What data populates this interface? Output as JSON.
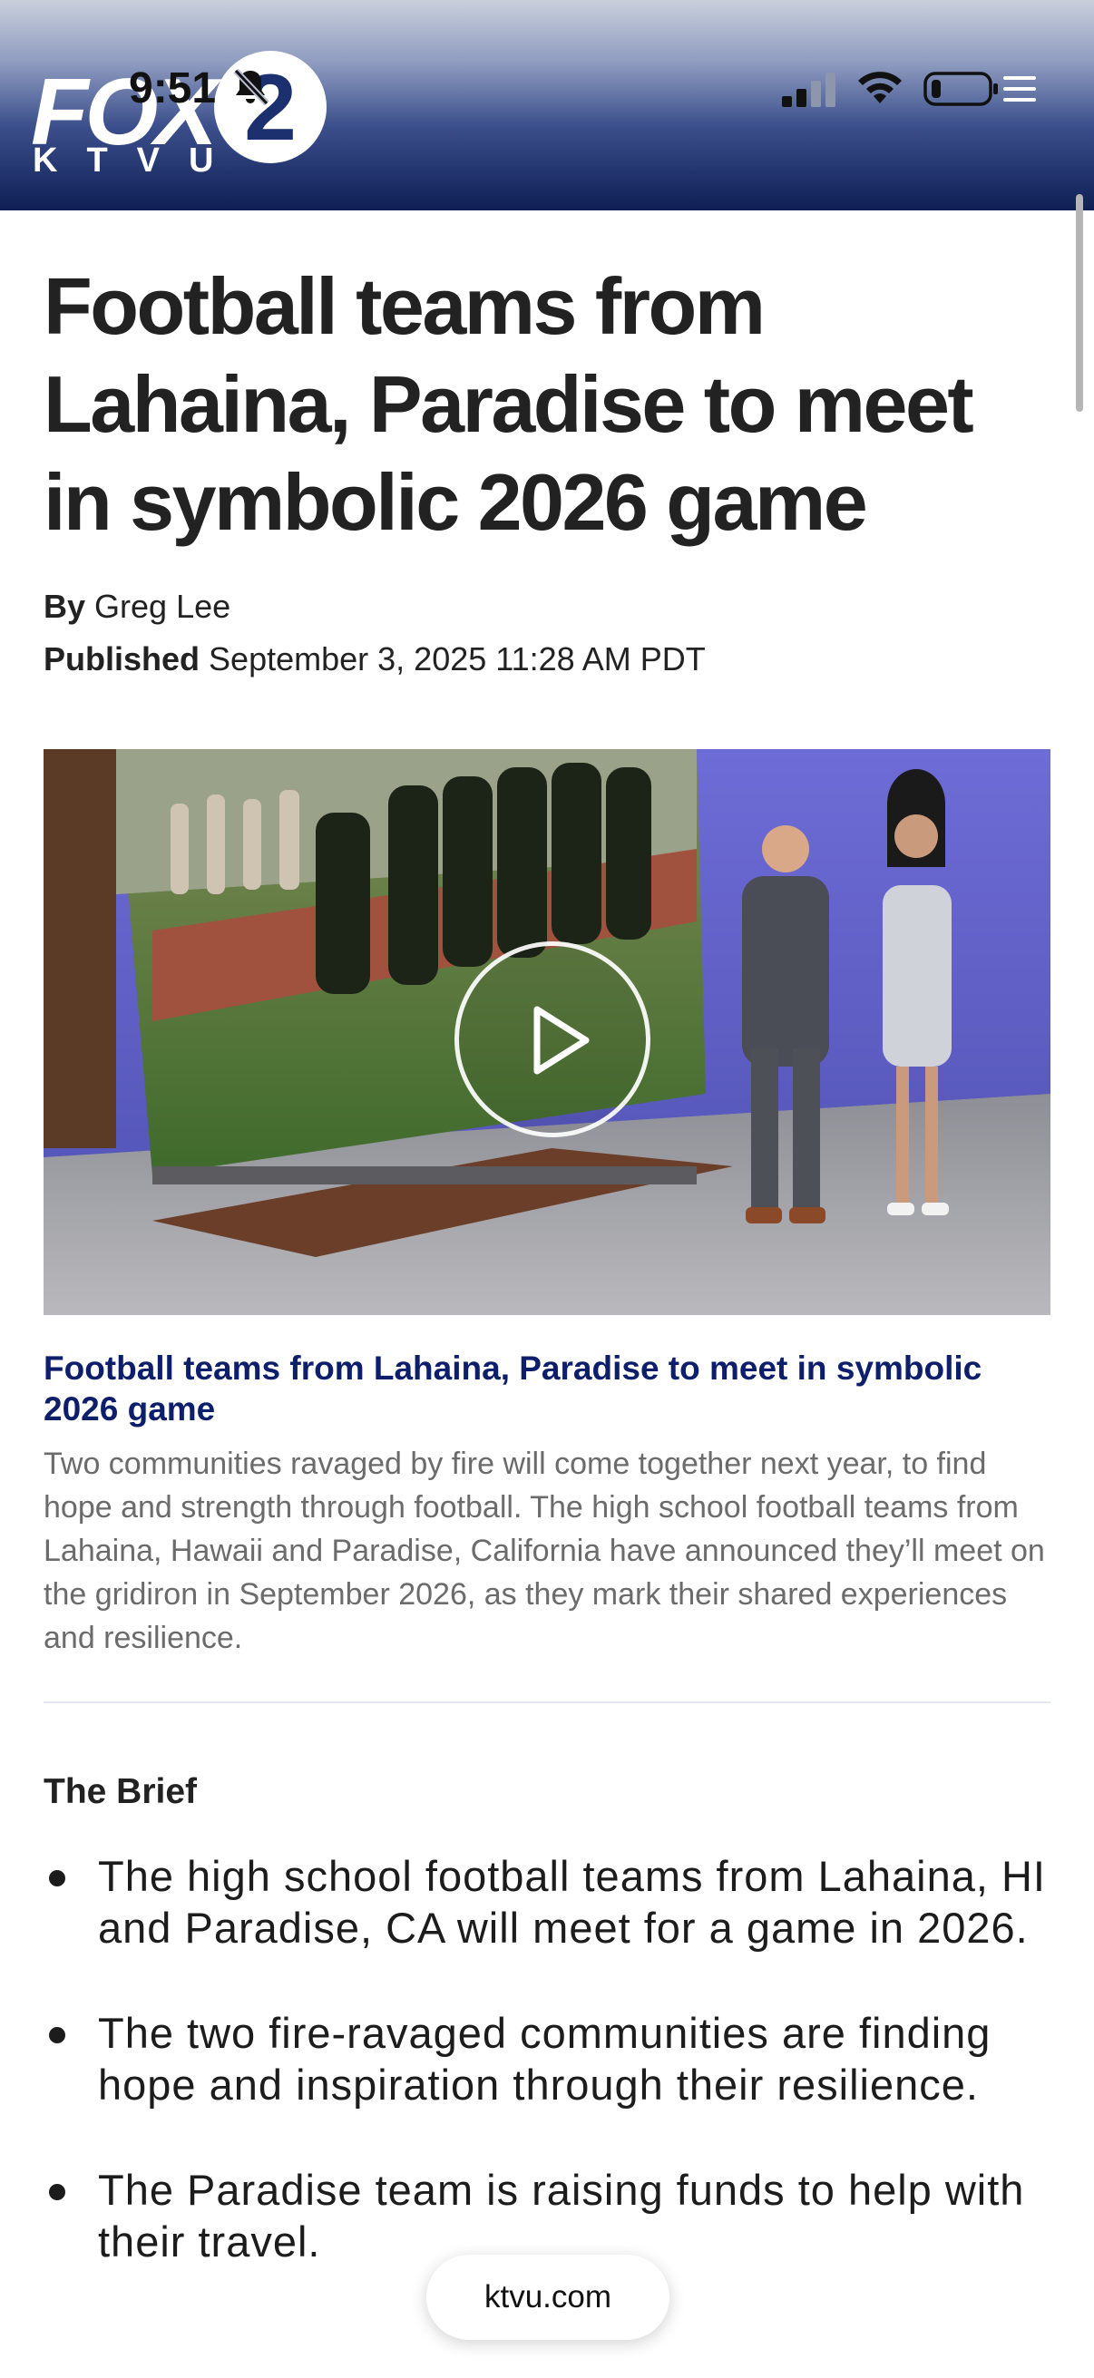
{
  "status_bar": {
    "time": "9:51"
  },
  "header": {
    "logo_fox": "FOX",
    "logo_ktvu": "KTVU",
    "logo_number": "2"
  },
  "article": {
    "headline": "Football teams from Lahaina, Paradise to meet in symbolic 2026 game",
    "byline_label": "By",
    "byline_author": "Greg Lee",
    "published_label": "Published",
    "published_date": "September 3, 2025 11:28 AM PDT"
  },
  "video": {
    "title": "Football teams from Lahaina, Paradise to meet in symbolic 2026 game",
    "description": "Two communities ravaged by fire will come together next year, to find hope and strength through football. The high school football teams from Lahaina, Hawaii and Paradise, California have announced they’ll meet on the gridiron in September 2026, as they mark their shared experiences and resilience."
  },
  "brief": {
    "title": "The Brief",
    "items": [
      "The high school football teams from Lahaina, HI and Paradise, CA will meet for a game in 2026.",
      "The two fire-ravaged communities are finding hope and inspiration through their resilience.",
      "The Paradise team is raising funds to help with their travel."
    ]
  },
  "browser": {
    "url": "ktvu.com"
  },
  "colors": {
    "header_dark": "#0f1f55",
    "link_blue": "#0d1f6b",
    "desc_gray": "#6b6b6b"
  }
}
